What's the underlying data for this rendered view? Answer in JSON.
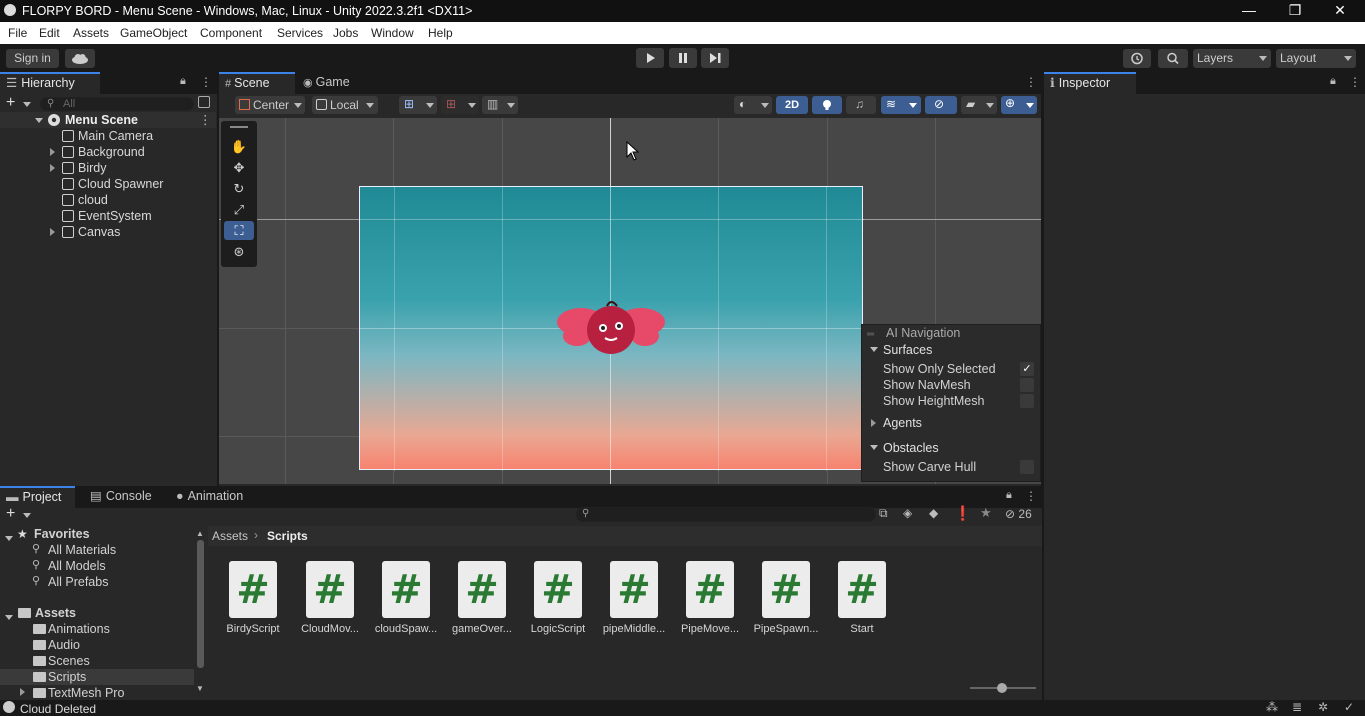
{
  "window": {
    "title": "FLORPY BORD - Menu Scene - Windows, Mac, Linux - Unity 2022.3.2f1 <DX11>",
    "controls": [
      "—",
      "❐",
      "✕"
    ]
  },
  "menu": [
    "File",
    "Edit",
    "Assets",
    "GameObject",
    "Component",
    "Services",
    "Jobs",
    "Window",
    "Help"
  ],
  "toolbar": {
    "sign_in": "Sign in",
    "layers": "Layers",
    "layout": "Layout"
  },
  "hierarchy": {
    "tab": "Hierarchy",
    "search_placeholder": "All",
    "scene": "Menu Scene",
    "items": [
      {
        "label": "Main Camera",
        "expandable": false
      },
      {
        "label": "Background",
        "expandable": true
      },
      {
        "label": "Birdy",
        "expandable": true
      },
      {
        "label": "Cloud Spawner",
        "expandable": false
      },
      {
        "label": "cloud",
        "expandable": false
      },
      {
        "label": "EventSystem",
        "expandable": false
      },
      {
        "label": "Canvas",
        "expandable": true
      }
    ]
  },
  "scene": {
    "tabs": [
      "Scene",
      "Game"
    ],
    "pivot": "Center",
    "space": "Local",
    "mode_2d": "2D"
  },
  "ai_navigation": {
    "title": "AI Navigation",
    "surfaces": "Surfaces",
    "show_only_selected": "Show Only Selected",
    "show_only_selected_checked": true,
    "show_navmesh": "Show NavMesh",
    "show_heightmesh": "Show HeightMesh",
    "agents": "Agents",
    "obstacles": "Obstacles",
    "show_carve_hull": "Show Carve Hull"
  },
  "inspector": {
    "tab": "Inspector"
  },
  "project": {
    "tabs": [
      "Project",
      "Console",
      "Animation"
    ],
    "favorites": "Favorites",
    "favorite_items": [
      "All Materials",
      "All Models",
      "All Prefabs"
    ],
    "assets": "Assets",
    "folders": [
      "Animations",
      "Audio",
      "Scenes",
      "Scripts",
      "TextMesh Pro"
    ],
    "selected_folder": "Scripts",
    "breadcrumb": [
      "Assets",
      "Scripts"
    ],
    "hidden_count": "26",
    "scripts": [
      "BirdyScript",
      "CloudMov...",
      "cloudSpaw...",
      "gameOver...",
      "LogicScript",
      "pipeMiddle...",
      "PipeMove...",
      "PipeSpawn...",
      "Start"
    ],
    "script_glyph": "#"
  },
  "status": {
    "message": "Cloud Deleted"
  }
}
